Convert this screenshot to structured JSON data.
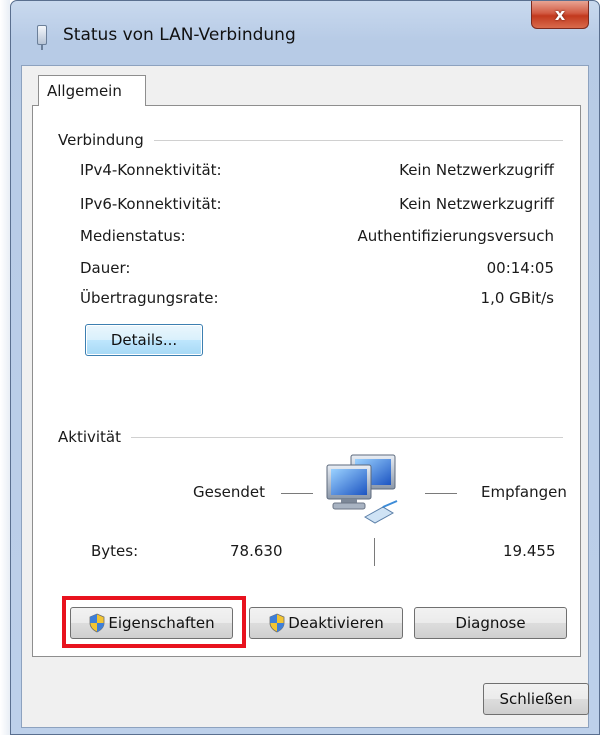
{
  "window": {
    "title": "Status von LAN-Verbindung",
    "close_label": "x"
  },
  "tabs": [
    {
      "label": "Allgemein",
      "selected": true
    }
  ],
  "connection": {
    "group_title": "Verbindung",
    "rows": [
      {
        "label": "IPv4-Konnektivität:",
        "value": "Kein Netzwerkzugriff"
      },
      {
        "label": "IPv6-Konnektivität:",
        "value": "Kein Netzwerkzugriff"
      },
      {
        "label": "Medienstatus:",
        "value": "Authentifizierungsversuch"
      },
      {
        "label": "Dauer:",
        "value": "00:14:05"
      },
      {
        "label": "Übertragungsrate:",
        "value": "1,0 GBit/s"
      }
    ],
    "details_button": "Details..."
  },
  "activity": {
    "group_title": "Aktivität",
    "sent_label": "Gesendet",
    "received_label": "Empfangen",
    "bytes_label": "Bytes:",
    "bytes_sent": "78.630",
    "bytes_received": "19.455"
  },
  "buttons": {
    "properties": "Eigenschaften",
    "disable": "Deaktivieren",
    "diagnose": "Diagnose",
    "close": "Schließen"
  },
  "colors": {
    "highlight": "#e8121e",
    "close_button": "#c2391e",
    "title_bar": "#b7cbe6"
  }
}
